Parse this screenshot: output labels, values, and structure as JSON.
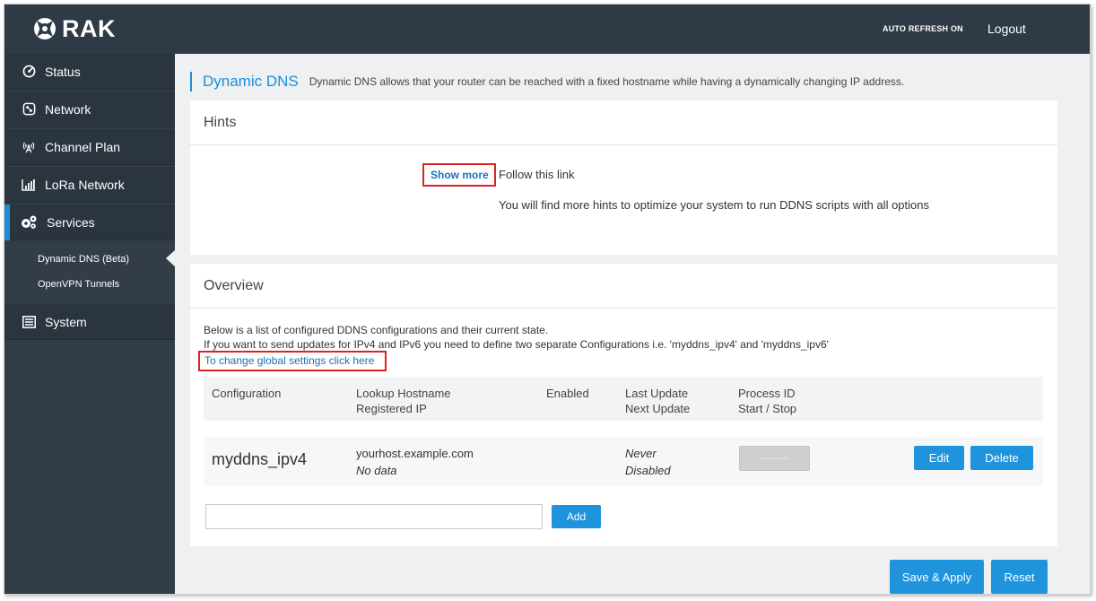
{
  "brand": {
    "name": "RAK"
  },
  "header": {
    "auto_refresh": "AUTO REFRESH ON",
    "logout": "Logout"
  },
  "sidebar": {
    "items": [
      {
        "label": "Status",
        "icon": "gauge-icon"
      },
      {
        "label": "Network",
        "icon": "network-icon"
      },
      {
        "label": "Channel Plan",
        "icon": "antenna-icon"
      },
      {
        "label": "LoRa Network",
        "icon": "signal-bars-icon"
      },
      {
        "label": "Services",
        "icon": "gears-icon"
      },
      {
        "label": "System",
        "icon": "list-icon"
      }
    ],
    "sub_items": [
      {
        "label": "Dynamic DNS (Beta)"
      },
      {
        "label": "OpenVPN Tunnels"
      }
    ],
    "active_color": "#1d8ed6"
  },
  "page": {
    "title": "Dynamic DNS",
    "description": "Dynamic DNS allows that your router can be reached with a fixed hostname while having a dynamically changing IP address."
  },
  "hints": {
    "title": "Hints",
    "show_more": "Show more",
    "follow": "Follow this link",
    "more_hints": "You will find more hints to optimize your system to run DDNS scripts with all options"
  },
  "overview": {
    "title": "Overview",
    "line1": "Below is a list of configured DDNS configurations and their current state.",
    "line2": "If you want to send updates for IPv4 and IPv6 you need to define two separate Configurations i.e. 'myddns_ipv4' and 'myddns_ipv6'",
    "global_link": "To change global settings click here",
    "columns": {
      "configuration": "Configuration",
      "lookup_hostname": "Lookup Hostname",
      "registered_ip": "Registered IP",
      "enabled": "Enabled",
      "last_update": "Last Update",
      "next_update": "Next Update",
      "process_id": "Process ID",
      "start_stop": "Start / Stop"
    },
    "rows": [
      {
        "name": "myddns_ipv4",
        "hostname": "yourhost.example.com",
        "ip": "No data",
        "last_update": "Never",
        "next_update": "Disabled",
        "process_button": "----------",
        "edit": "Edit",
        "delete": "Delete"
      }
    ],
    "add_input": {
      "value": "",
      "placeholder": ""
    },
    "add_button": "Add"
  },
  "footer": {
    "save_apply": "Save & Apply",
    "reset": "Reset"
  },
  "colors": {
    "accent": "#1d8ed6",
    "highlight": "#d22222",
    "topbar": "#2e3a45"
  }
}
